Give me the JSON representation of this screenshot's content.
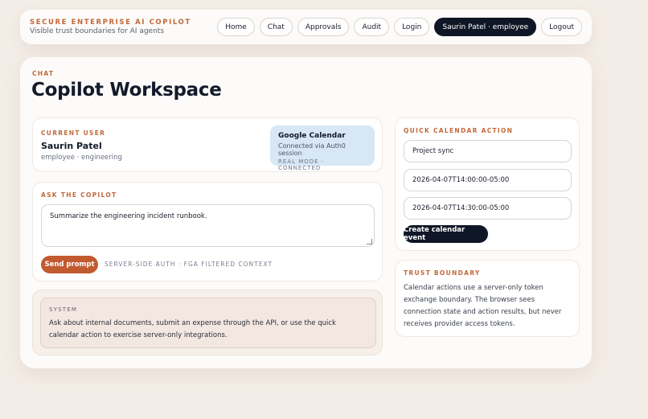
{
  "brand": {
    "title": "SECURE ENTERPRISE AI COPILOT",
    "subtitle": "Visible trust boundaries for AI agents"
  },
  "nav": {
    "home": "Home",
    "chat": "Chat",
    "approvals": "Approvals",
    "audit": "Audit",
    "login": "Login",
    "user": "Saurin Patel · employee",
    "logout": "Logout"
  },
  "page": {
    "eyebrow": "CHAT",
    "title": "Copilot Workspace"
  },
  "current_user": {
    "label": "CURRENT USER",
    "name": "Saurin Patel",
    "role": "employee · engineering"
  },
  "google_calendar": {
    "title": "Google Calendar",
    "status": "Connected via Auth0 session",
    "mode": "REAL MODE · CONNECTED"
  },
  "ask": {
    "label": "ASK THE COPILOT",
    "prompt_value": "Summarize the engineering incident runbook.",
    "send_label": "Send prompt",
    "note": "SERVER-SIDE AUTH · FGA FILTERED CONTEXT"
  },
  "system": {
    "label": "SYSTEM",
    "message": "Ask about internal documents, submit an expense through the API, or use the quick calendar action to exercise server-only integrations."
  },
  "quick_calendar": {
    "label": "QUICK CALENDAR ACTION",
    "title_value": "Project sync",
    "start_value": "2026-04-07T14:00:00-05:00",
    "end_value": "2026-04-07T14:30:00-05:00",
    "create_label": "Create calendar event"
  },
  "trust_boundary": {
    "label": "TRUST BOUNDARY",
    "text": "Calendar actions use a server-only token exchange boundary. The browser sees connection state and action results, but never receives provider access tokens."
  },
  "colors": {
    "accent": "#c2683a",
    "primary_dark": "#0f1626",
    "send_button": "#c25a30",
    "calendar_badge": "#d7e7f4",
    "background": "#f4ede7"
  }
}
